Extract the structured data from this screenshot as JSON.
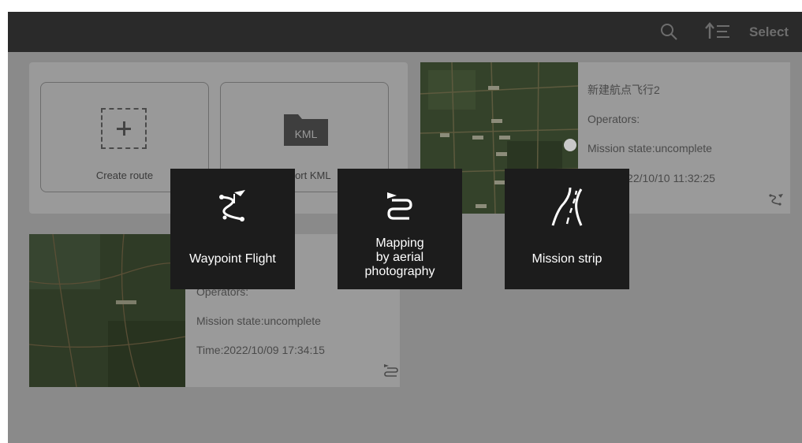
{
  "topbar": {
    "search_icon": "search-icon",
    "sort_icon": "sort-icon",
    "select_label": "Select"
  },
  "create_card": {
    "create_route_label": "Create route",
    "import_kml_label": "Import KML",
    "kml_badge": "KML"
  },
  "missions": [
    {
      "name": "新建航点飞行2",
      "operators": "Operators:",
      "state": "Mission state:uncomplete",
      "time": "Time:2022/10/10 11:32:25",
      "type_icon": "waypoint-flight-icon"
    },
    {
      "name": "",
      "operators": "Operators:",
      "state": "Mission state:uncomplete",
      "time": "Time:2022/10/09 17:34:15",
      "type_icon": "aerial-mapping-icon"
    }
  ],
  "route_type_popup": [
    {
      "label": "Waypoint Flight",
      "icon": "waypoint-flight-icon"
    },
    {
      "label": "Mapping\nby aerial\nphotography",
      "label_lines": [
        "Mapping",
        "by aerial",
        "photography"
      ],
      "icon": "aerial-mapping-icon"
    },
    {
      "label": "Mission strip",
      "icon": "mission-strip-icon"
    }
  ],
  "colors": {
    "topbar": "#2a2a2a",
    "overlay_bg": "#8a8a8a",
    "popup_button": "#1c1c1c",
    "popup_text": "#ffffff"
  }
}
